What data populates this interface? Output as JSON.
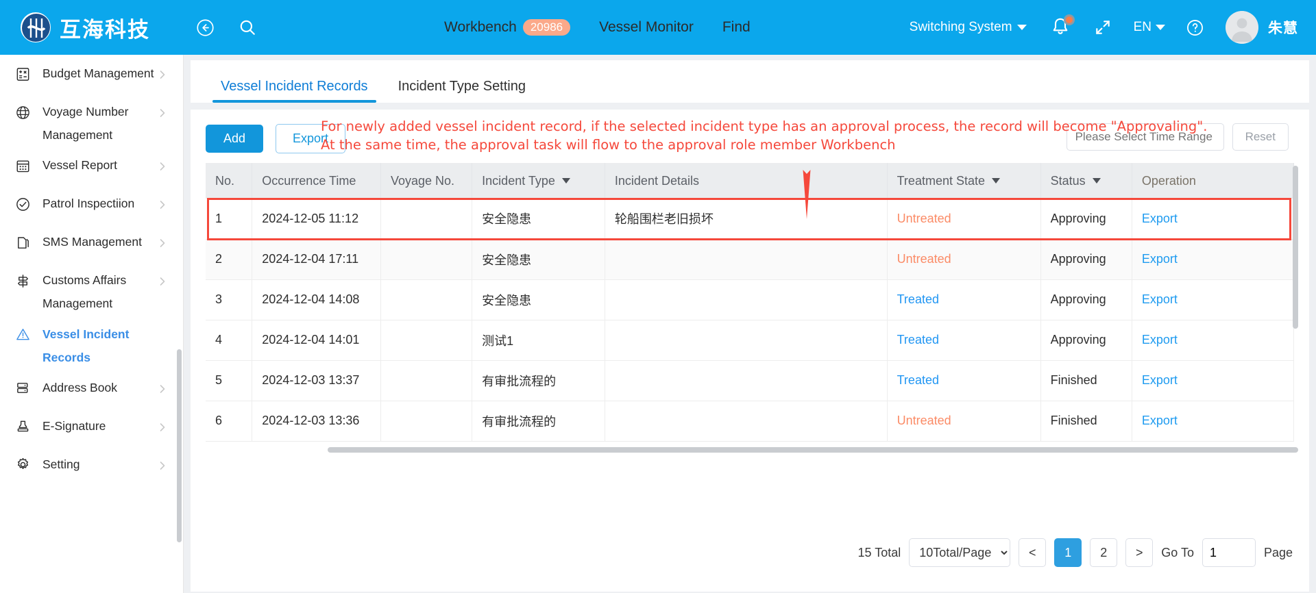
{
  "header": {
    "brand_name": "互海科技",
    "back_icon": "back-arrow-icon",
    "search_icon": "search-icon",
    "nav": [
      {
        "label": "Workbench",
        "badge": "20986"
      },
      {
        "label": "Vessel Monitor",
        "badge": ""
      },
      {
        "label": "Find",
        "badge": ""
      }
    ],
    "switch_system_label": "Switching System",
    "language_label": "EN",
    "user_name": "朱慧",
    "bell_icon": "notification-bell-icon",
    "expand_icon": "fullscreen-expand-icon",
    "help_icon": "help-question-icon",
    "avatar_icon": "user-avatar-icon"
  },
  "sidebar": {
    "items": [
      {
        "label": "Budget Management",
        "icon": "calculator-icon",
        "active": false
      },
      {
        "label": "Voyage Number Management",
        "icon": "globe-icon",
        "active": false
      },
      {
        "label": "Vessel Report",
        "icon": "calendar-icon",
        "active": false
      },
      {
        "label": "Patrol Inspectiion",
        "icon": "check-circle-icon",
        "active": false
      },
      {
        "label": "SMS Management",
        "icon": "documents-icon",
        "active": false
      },
      {
        "label": "Customs Affairs Management",
        "icon": "signpost-icon",
        "active": false
      },
      {
        "label": "Vessel Incident Records",
        "icon": "warning-triangle-icon",
        "active": true
      },
      {
        "label": "Address Book",
        "icon": "address-book-icon",
        "active": false
      },
      {
        "label": "E-Signature",
        "icon": "stamp-icon",
        "active": false
      },
      {
        "label": "Setting",
        "icon": "gear-icon",
        "active": false
      }
    ]
  },
  "tabs": [
    {
      "label": "Vessel Incident Records",
      "active": true
    },
    {
      "label": "Incident Type Setting",
      "active": false
    }
  ],
  "toolbar": {
    "add_label": "Add",
    "export_label": "Export",
    "time_range_placeholder": "Please Select Time Range",
    "reset_label": "Reset"
  },
  "annotation": {
    "line1": "For newly added vessel incident record, if the selected incident type has an approval process, the record will become \"Approvaling\".",
    "line2": "At the same time, the approval task will flow to the approval role member Workbench",
    "color": "#F5483B"
  },
  "table": {
    "columns": [
      {
        "label": "No.",
        "sortable": false
      },
      {
        "label": "Occurrence Time",
        "sortable": false
      },
      {
        "label": "Voyage No.",
        "sortable": false
      },
      {
        "label": "Incident Type",
        "sortable": true
      },
      {
        "label": "Incident Details",
        "sortable": false
      },
      {
        "label": "Treatment State",
        "sortable": true
      },
      {
        "label": "Status",
        "sortable": true
      },
      {
        "label": "Operation",
        "sortable": false
      }
    ],
    "rows": [
      {
        "no": "1",
        "time": "2024-12-05 11:12",
        "voyage": "",
        "type": "安全隐患",
        "details": "轮船围栏老旧损坏",
        "treatment": "Untreated",
        "status": "Approving",
        "operation": "Export"
      },
      {
        "no": "2",
        "time": "2024-12-04 17:11",
        "voyage": "",
        "type": "安全隐患",
        "details": "",
        "treatment": "Untreated",
        "status": "Approving",
        "operation": "Export"
      },
      {
        "no": "3",
        "time": "2024-12-04 14:08",
        "voyage": "",
        "type": "安全隐患",
        "details": "",
        "treatment": "Treated",
        "status": "Approving",
        "operation": "Export"
      },
      {
        "no": "4",
        "time": "2024-12-04 14:01",
        "voyage": "",
        "type": "测试1",
        "details": "",
        "treatment": "Treated",
        "status": "Approving",
        "operation": "Export"
      },
      {
        "no": "5",
        "time": "2024-12-03 13:37",
        "voyage": "",
        "type": "有审批流程的",
        "details": "",
        "treatment": "Treated",
        "status": "Finished",
        "operation": "Export"
      },
      {
        "no": "6",
        "time": "2024-12-03 13:36",
        "voyage": "",
        "type": "有审批流程的",
        "details": "",
        "treatment": "Untreated",
        "status": "Finished",
        "operation": "Export"
      }
    ],
    "colors": {
      "untreated": "#FB8B66",
      "treated": "#2196F3",
      "link": "#1E9BF0",
      "highlight_border": "#F5483B"
    }
  },
  "pagination": {
    "total_label": "15 Total",
    "page_size_label": "10Total/Page",
    "prev_label": "<",
    "pages": [
      "1",
      "2"
    ],
    "current_page": "1",
    "next_label": ">",
    "goto_label": "Go To",
    "goto_value": "1",
    "page_label": "Page"
  }
}
